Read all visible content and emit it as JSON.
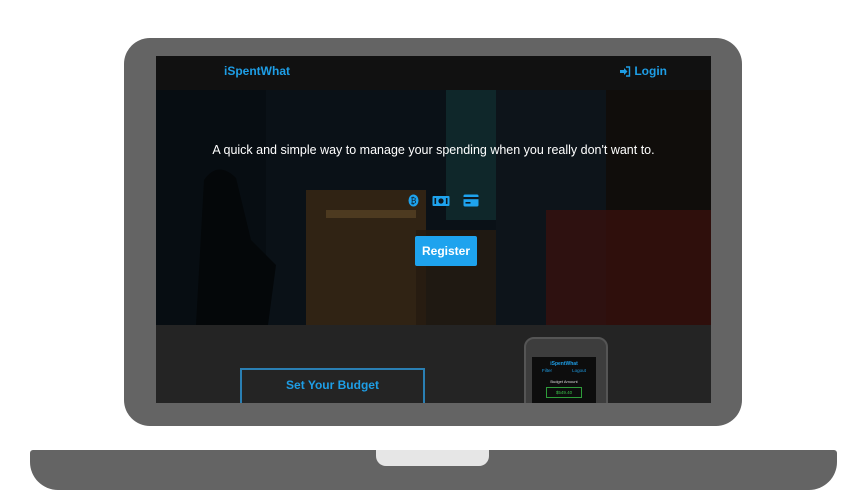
{
  "app": {
    "brand": "iSpentWhat",
    "login_label": "Login"
  },
  "hero": {
    "tagline": "A quick and simple way to manage your spending when you really don't want to.",
    "register_label": "Register",
    "icons": [
      "bitcoin-icon",
      "cash-icon",
      "credit-card-icon"
    ]
  },
  "lower": {
    "budget_label": "Set Your Budget",
    "phone": {
      "brand": "iSpentWhat",
      "filter_label": "Filter",
      "logout_label": "Logout",
      "budget_amount_label": "Budget Amount",
      "budget_amount_value": "$549.40"
    }
  },
  "colors": {
    "accent": "#1e9ee6",
    "button": "#1ea3ee",
    "laptop_frame": "#646464",
    "nav_bg": "#111111",
    "lower_bg": "#242424",
    "money_green": "#3bc24a"
  }
}
